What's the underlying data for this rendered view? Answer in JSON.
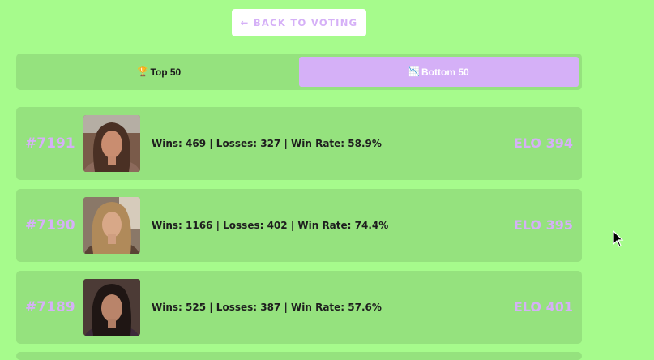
{
  "back_button": {
    "label": "← BACK TO VOTING"
  },
  "tabs": [
    {
      "icon": "trophy-icon",
      "glyph": "🏆",
      "label": "Top 50",
      "active": false
    },
    {
      "icon": "chart-down-icon",
      "glyph": "📉",
      "label": "Bottom 50",
      "active": true
    }
  ],
  "leaderboard": [
    {
      "rank": "#7191",
      "stats": "Wins: 469 | Losses: 327 | Win Rate: 58.9%",
      "elo": "ELO 394"
    },
    {
      "rank": "#7190",
      "stats": "Wins: 1166 | Losses: 402 | Win Rate: 74.4%",
      "elo": "ELO 395"
    },
    {
      "rank": "#7189",
      "stats": "Wins: 525 | Losses: 387 | Win Rate: 57.6%",
      "elo": "ELO 401"
    }
  ],
  "colors": {
    "background": "#a6fb8c",
    "card": "#95e27e",
    "accent": "#d5b0f7"
  }
}
